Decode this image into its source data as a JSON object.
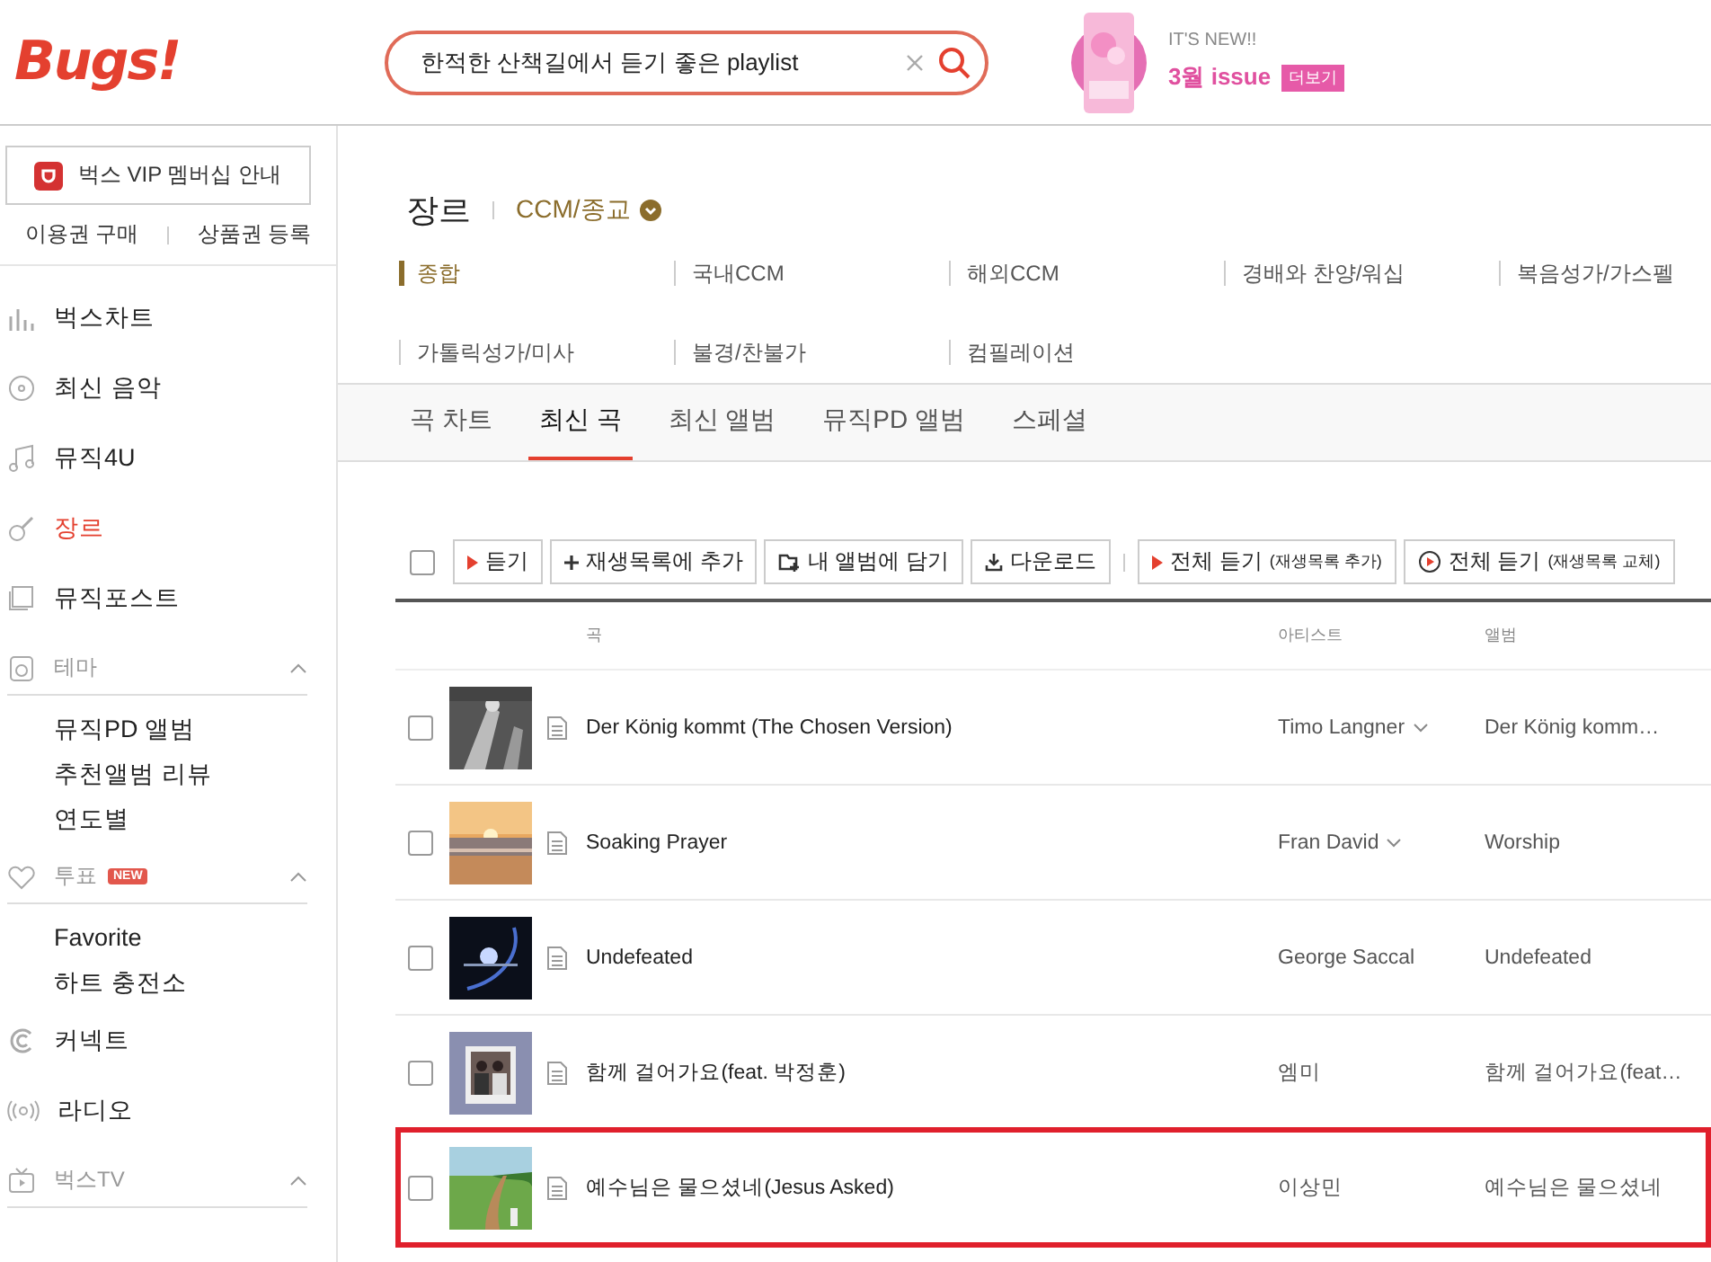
{
  "header": {
    "logo": "Bugs!",
    "search": {
      "value": "한적한 산책길에서 듣기 좋은 playlist"
    },
    "promo": {
      "eyebrow": "IT'S NEW!!",
      "title": "3월 issue",
      "badge": "더보기"
    }
  },
  "sidebar": {
    "vip_button": "벅스 VIP 멤버십 안내",
    "links": [
      "이용권 구매",
      "상품권 등록"
    ],
    "items": [
      {
        "kind": "nav",
        "label": "벅스차트",
        "selected": false
      },
      {
        "kind": "nav",
        "label": "최신 음악",
        "selected": false
      },
      {
        "kind": "nav",
        "label": "뮤직4U",
        "selected": false
      },
      {
        "kind": "nav",
        "label": "장르",
        "selected": true
      },
      {
        "kind": "nav",
        "label": "뮤직포스트",
        "selected": false
      },
      {
        "kind": "section",
        "label": "테마",
        "expanded": true,
        "children": [
          {
            "label": "뮤직PD 앨범"
          },
          {
            "label": "추천앨범 리뷰"
          },
          {
            "label": "연도별"
          }
        ]
      },
      {
        "kind": "section",
        "label": "투표",
        "badge": "NEW",
        "expanded": true,
        "children": [
          {
            "label": "Favorite"
          },
          {
            "label": "하트 충전소"
          }
        ]
      },
      {
        "kind": "nav",
        "label": "커넥트",
        "selected": false
      },
      {
        "kind": "nav",
        "label": "라디오",
        "selected": false
      },
      {
        "kind": "section",
        "label": "벅스TV",
        "expanded": true
      }
    ]
  },
  "genre": {
    "title": "장르",
    "category": "CCM/종교",
    "subgenres": [
      {
        "label": "종합",
        "selected": true
      },
      {
        "label": "국내CCM",
        "selected": false
      },
      {
        "label": "해외CCM",
        "selected": false
      },
      {
        "label": "경배와 찬양/워십",
        "selected": false
      },
      {
        "label": "복음성가/가스펠",
        "selected": false
      },
      {
        "label": "가톨릭성가/미사",
        "selected": false
      },
      {
        "label": "불경/찬불가",
        "selected": false
      },
      {
        "label": "컴필레이션",
        "selected": false
      }
    ]
  },
  "tabs": [
    {
      "label": "곡 차트",
      "selected": false
    },
    {
      "label": "최신 곡",
      "selected": true
    },
    {
      "label": "최신 앨범",
      "selected": false
    },
    {
      "label": "뮤직PD 앨범",
      "selected": false
    },
    {
      "label": "스페셜",
      "selected": false
    }
  ],
  "toolbar": {
    "select_all": {
      "checked": false
    },
    "groups": [
      [
        {
          "kind": "play",
          "label": "듣기"
        },
        {
          "kind": "add",
          "label": "재생목록에 추가"
        },
        {
          "kind": "album",
          "label": "내 앨범에 담기"
        },
        {
          "kind": "download",
          "label": "다운로드"
        }
      ],
      [
        {
          "kind": "play",
          "label": "전체 듣기",
          "note": "(재생목록 추가)"
        },
        {
          "kind": "replace",
          "label": "전체 듣기",
          "note": "(재생목록 교체)"
        }
      ]
    ]
  },
  "table": {
    "columns": [
      "곡",
      "아티스트",
      "앨범"
    ],
    "rows": [
      {
        "title": "Der König kommt (The Chosen Version)",
        "artist": "Timo Langner",
        "artist_menu": true,
        "album": "Der König komm…",
        "checked": false,
        "highlighted": false
      },
      {
        "title": "Soaking Prayer",
        "artist": "Fran David",
        "artist_menu": true,
        "album": "Worship",
        "checked": false,
        "highlighted": false
      },
      {
        "title": "Undefeated",
        "artist": "George Saccal",
        "artist_menu": false,
        "album": "Undefeated",
        "checked": false,
        "highlighted": false
      },
      {
        "title": "함께 걸어가요(feat. 박정훈)",
        "artist": "엠미",
        "artist_menu": false,
        "album": "함께 걸어가요(feat…",
        "checked": false,
        "highlighted": false
      },
      {
        "title": "예수님은 물으셨네(Jesus Asked)",
        "artist": "이상민",
        "artist_menu": false,
        "album": "예수님은 물으셨네",
        "checked": false,
        "highlighted": true
      }
    ]
  }
}
